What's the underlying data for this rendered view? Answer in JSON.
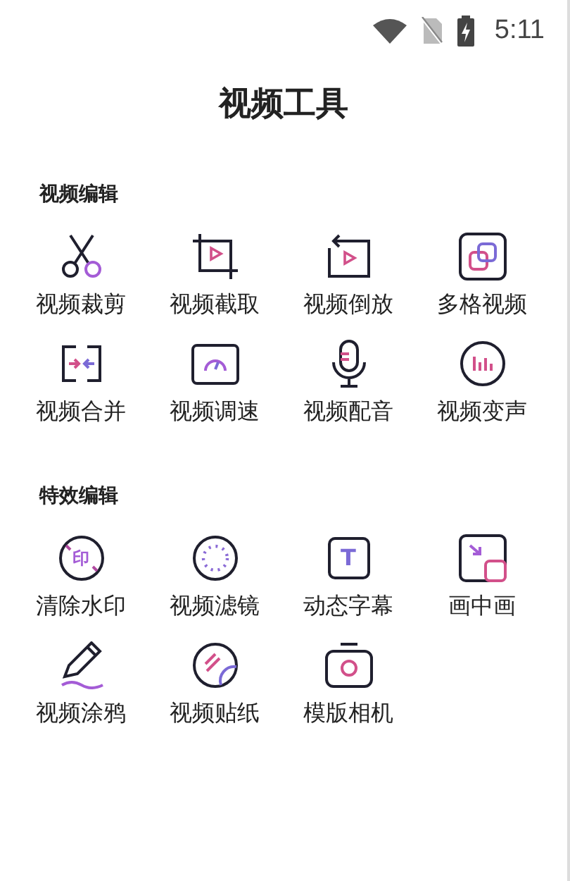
{
  "status_bar": {
    "time": "5:11"
  },
  "title": "视频工具",
  "sections": [
    {
      "heading": "视频编辑",
      "tools": [
        {
          "label": "视频裁剪",
          "kind": "scissors"
        },
        {
          "label": "视频截取",
          "kind": "crop"
        },
        {
          "label": "视频倒放",
          "kind": "reverse"
        },
        {
          "label": "多格视频",
          "kind": "grid"
        },
        {
          "label": "视频合并",
          "kind": "merge"
        },
        {
          "label": "视频调速",
          "kind": "speed"
        },
        {
          "label": "视频配音",
          "kind": "mic"
        },
        {
          "label": "视频变声",
          "kind": "voice"
        }
      ]
    },
    {
      "heading": "特效编辑",
      "tools": [
        {
          "label": "清除水印",
          "kind": "stamp",
          "icon_text": "印"
        },
        {
          "label": "视频滤镜",
          "kind": "filter"
        },
        {
          "label": "动态字幕",
          "kind": "caption",
          "icon_text": "T"
        },
        {
          "label": "画中画",
          "kind": "pip"
        },
        {
          "label": "视频涂鸦",
          "kind": "pen"
        },
        {
          "label": "视频贴纸",
          "kind": "sticker"
        },
        {
          "label": "模版相机",
          "kind": "camera"
        }
      ]
    }
  ]
}
